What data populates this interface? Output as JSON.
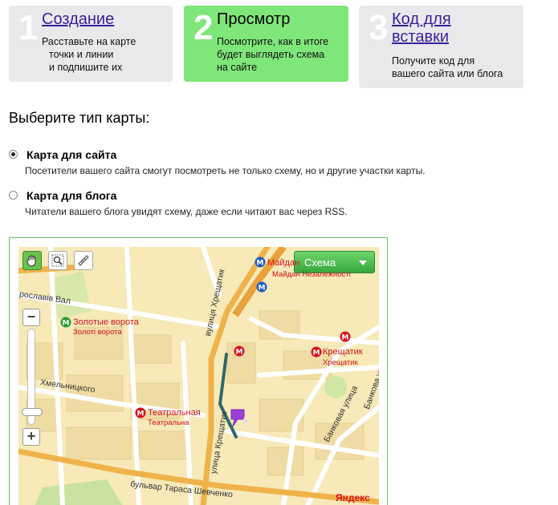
{
  "steps": [
    {
      "number": "1",
      "title": "Создание",
      "description": [
        "Расставьте на карте",
        "точки и линии",
        "и подпишите их"
      ]
    },
    {
      "number": "2",
      "title": "Просмотр",
      "description": [
        "Посмотрите, как в итоге",
        "будет выглядеть схема",
        "на сайте"
      ]
    },
    {
      "number": "3",
      "title": "Код для вставки",
      "description": [
        "Получите код для",
        "вашего сайта или блога"
      ]
    }
  ],
  "section_title": "Выберите тип карты:",
  "options": [
    {
      "label": "Карта для сайта",
      "hint": "Посетители вашего сайта смогут посмотреть не только схему, но и другие участки карты.",
      "checked": true
    },
    {
      "label": "Карта для блога",
      "hint": "Читатели вашего блога увидят схему, даже если читают вас через RSS.",
      "checked": false
    }
  ],
  "map": {
    "type_selector": "Схема",
    "zoom_minus": "−",
    "zoom_plus": "+",
    "brand": "Яндекс",
    "metro_stations": [
      {
        "name": "Майдан",
        "sub": "Майдан Незалежності",
        "color": "#1f5bc9"
      },
      {
        "name": "Золотые ворота",
        "sub": "Золоті ворота",
        "color": "#2a9b2e"
      },
      {
        "name": "Крещатик",
        "sub": "Хрещатик",
        "color": "#d4101b"
      },
      {
        "name": "Театральная",
        "sub": "Театральна",
        "color": "#d4101b"
      }
    ],
    "streets": [
      "вулиця Хрещатик",
      "улица Крещатик",
      "бульвар Тараса Шевченко",
      "Банковая улица",
      "Банкова улица",
      "Хмельницкого",
      "рославів Вал"
    ],
    "route_color": "#2f6a6a",
    "marker_color": "#9b3fd6"
  }
}
